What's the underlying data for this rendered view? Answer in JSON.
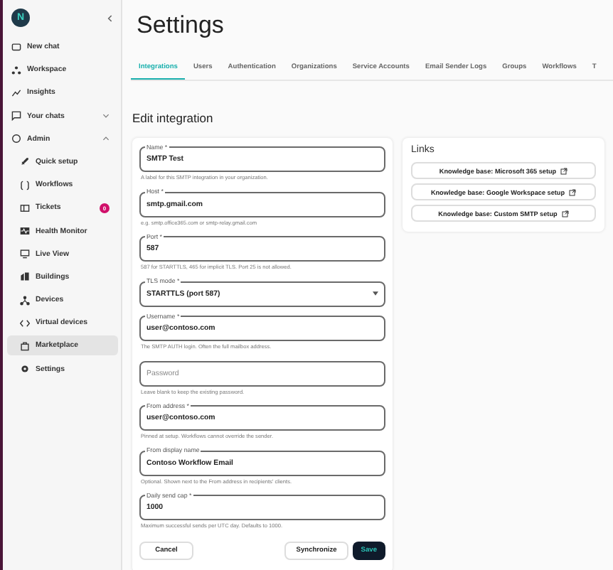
{
  "sidebar": {
    "logo": "N",
    "items": [
      {
        "label": "New chat",
        "selected": false
      },
      {
        "label": "Workspace",
        "selected": false
      },
      {
        "label": "Insights",
        "selected": false
      },
      {
        "label": "Your chats",
        "selected": false,
        "expanded": false
      },
      {
        "label": "Admin",
        "selected": false,
        "expanded": true,
        "children": [
          {
            "label": "Quick setup",
            "selected": false
          },
          {
            "label": "Workflows",
            "selected": false
          },
          {
            "label": "Tickets",
            "selected": false,
            "badge": "0"
          },
          {
            "label": "Health Monitor",
            "selected": false
          },
          {
            "label": "Live View",
            "selected": false
          },
          {
            "label": "Buildings",
            "selected": false
          },
          {
            "label": "Devices",
            "selected": false
          },
          {
            "label": "Virtual devices",
            "selected": false
          },
          {
            "label": "Marketplace",
            "selected": true
          },
          {
            "label": "Settings",
            "selected": false
          }
        ]
      }
    ]
  },
  "title": "Settings",
  "tabs": [
    {
      "label": "Integrations",
      "selected": true
    },
    {
      "label": "Users",
      "selected": false
    },
    {
      "label": "Authentication",
      "selected": false
    },
    {
      "label": "Organizations",
      "selected": false
    },
    {
      "label": "Service Accounts",
      "selected": false
    },
    {
      "label": "Email Sender Logs",
      "selected": false
    },
    {
      "label": "Groups",
      "selected": false
    },
    {
      "label": "Workflows",
      "selected": false
    },
    {
      "label": "T",
      "selected": false
    }
  ],
  "section_title": "Edit integration",
  "form": {
    "fields": [
      {
        "kind": "text",
        "label": "Name *",
        "value": "SMTP Test",
        "helper": "A label for this SMTP integration in your organization."
      },
      {
        "kind": "text",
        "label": "Host *",
        "value": "smtp.gmail.com",
        "helper": "e.g. smtp.office365.com or smtp-relay.gmail.com"
      },
      {
        "kind": "text",
        "label": "Port *",
        "value": "587",
        "helper": "587 for STARTTLS, 465 for implicit TLS. Port 25 is not allowed."
      },
      {
        "kind": "select",
        "label": "TLS mode *",
        "value": "STARTTLS (port 587)"
      },
      {
        "kind": "text",
        "label": "Username *",
        "value": "user@contoso.com",
        "helper": "The SMTP AUTH login. Often the full mailbox address."
      },
      {
        "kind": "text",
        "placeholder": "Password",
        "helper": "Leave blank to keep the existing password."
      },
      {
        "kind": "text",
        "label": "From address *",
        "value": "user@contoso.com",
        "helper": "Pinned at setup. Workflows cannot override the sender."
      },
      {
        "kind": "text",
        "label": "From display name",
        "value": "Contoso Workflow Email",
        "helper": "Optional. Shown next to the From address in recipients' clients."
      },
      {
        "kind": "text",
        "label": "Daily send cap *",
        "value": "1000",
        "helper": "Maximum successful sends per UTC day. Defaults to 1000."
      }
    ],
    "buttons": [
      {
        "label": "Cancel",
        "kind": "outline"
      },
      {
        "label": "Synchronize",
        "kind": "outline"
      },
      {
        "label": "Save",
        "kind": "primary"
      }
    ]
  },
  "links": {
    "title": "Links",
    "items": [
      "Knowledge base: Microsoft 365 setup",
      "Knowledge base: Google Workspace setup",
      "Knowledge base: Custom SMTP setup"
    ]
  }
}
